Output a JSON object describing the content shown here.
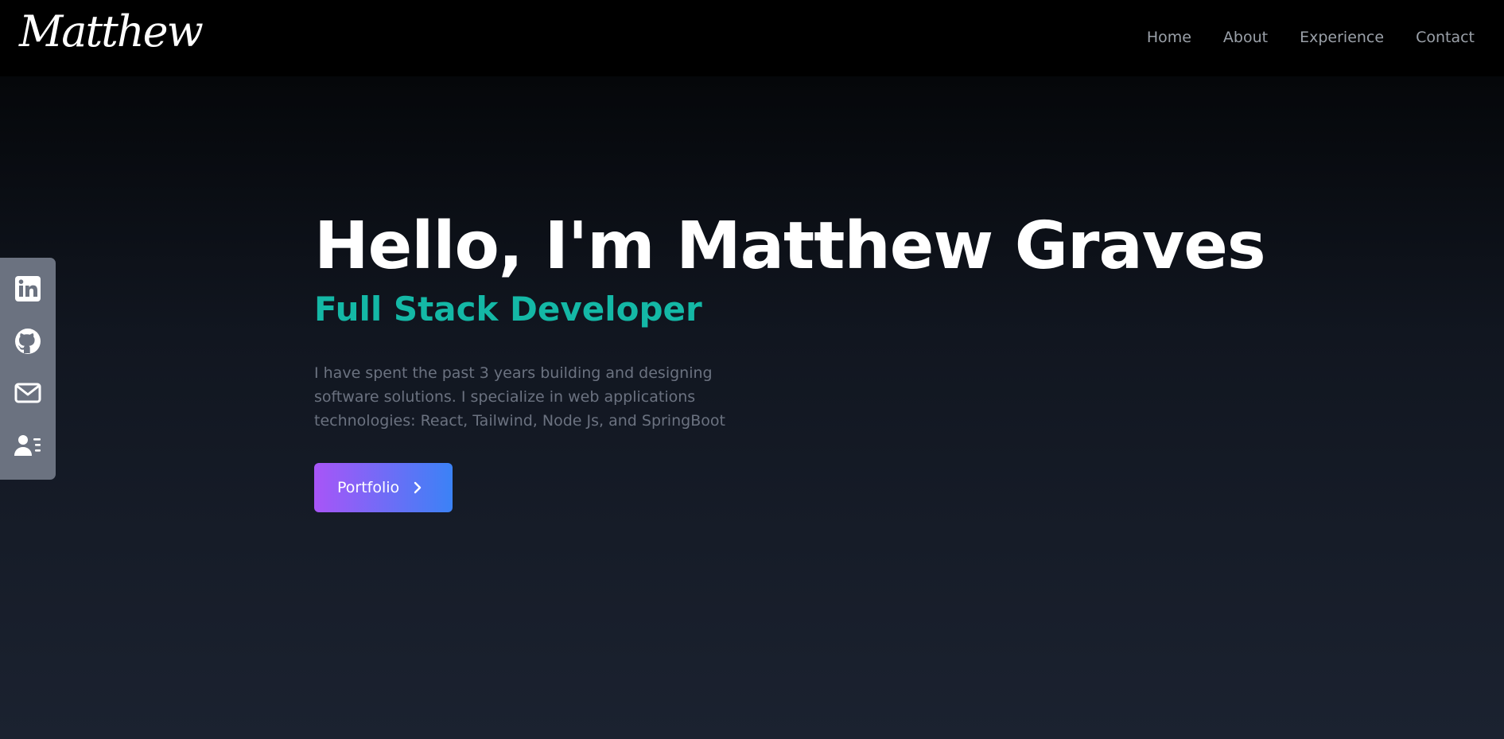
{
  "header": {
    "logo_text": "Matthew",
    "nav": [
      {
        "label": "Home"
      },
      {
        "label": "About"
      },
      {
        "label": "Experience"
      },
      {
        "label": "Contact"
      }
    ]
  },
  "social_bar": {
    "items": [
      {
        "icon": "linkedin-icon"
      },
      {
        "icon": "github-icon"
      },
      {
        "icon": "mail-icon"
      },
      {
        "icon": "resume-icon"
      }
    ],
    "bg_color": "#6b7280"
  },
  "hero": {
    "title": "Hello, I'm Matthew Graves",
    "subtitle": "Full Stack Developer",
    "description": "I have spent the past 3 years building and designing software solutions. I specialize in web applications technologies: React, Tailwind, Node Js, and SpringBoot",
    "cta_label": "Portfolio",
    "cta_icon": "chevron-right-icon"
  },
  "colors": {
    "accent": "#14b8a6",
    "button_gradient_start": "#a855f7",
    "button_gradient_end": "#3b82f6",
    "header_bg": "#000000",
    "nav_text": "#9aa0a8"
  }
}
